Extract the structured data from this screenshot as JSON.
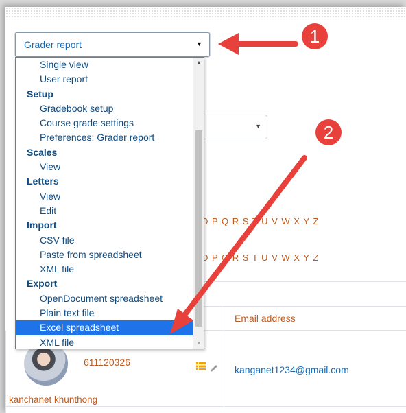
{
  "report_select": {
    "selected": "Grader report"
  },
  "dropdown": {
    "items": [
      {
        "type": "option",
        "label": "Single view"
      },
      {
        "type": "option",
        "label": "User report"
      },
      {
        "type": "group",
        "label": "Setup"
      },
      {
        "type": "option",
        "label": "Gradebook setup"
      },
      {
        "type": "option",
        "label": "Course grade settings"
      },
      {
        "type": "option",
        "label": "Preferences: Grader report"
      },
      {
        "type": "group",
        "label": "Scales"
      },
      {
        "type": "option",
        "label": "View"
      },
      {
        "type": "group",
        "label": "Letters"
      },
      {
        "type": "option",
        "label": "View"
      },
      {
        "type": "option",
        "label": "Edit"
      },
      {
        "type": "group",
        "label": "Import"
      },
      {
        "type": "option",
        "label": "CSV file"
      },
      {
        "type": "option",
        "label": "Paste from spreadsheet"
      },
      {
        "type": "option",
        "label": "XML file"
      },
      {
        "type": "group",
        "label": "Export"
      },
      {
        "type": "option",
        "label": "OpenDocument spreadsheet"
      },
      {
        "type": "option",
        "label": "Plain text file"
      },
      {
        "type": "option",
        "label": "Excel spreadsheet",
        "selected": true
      },
      {
        "type": "option",
        "label": "XML file"
      }
    ]
  },
  "background": {
    "letters_row_1": "D P Q R S T U V W X Y Z",
    "letters_row_2": "D P Q R S T U V W X Y Z",
    "table": {
      "header_email": "Email address",
      "row": {
        "student_id": "611120326",
        "student_name": "kanchanet khunthong",
        "email": "kanganet1234@gmail.com"
      }
    }
  },
  "annotations": {
    "badges": [
      "1",
      "2"
    ],
    "color": "#e8403a"
  },
  "colors": {
    "link": "#bf5b1e",
    "highlight": "#1e73e8",
    "text_blue": "#0f6cbf"
  }
}
